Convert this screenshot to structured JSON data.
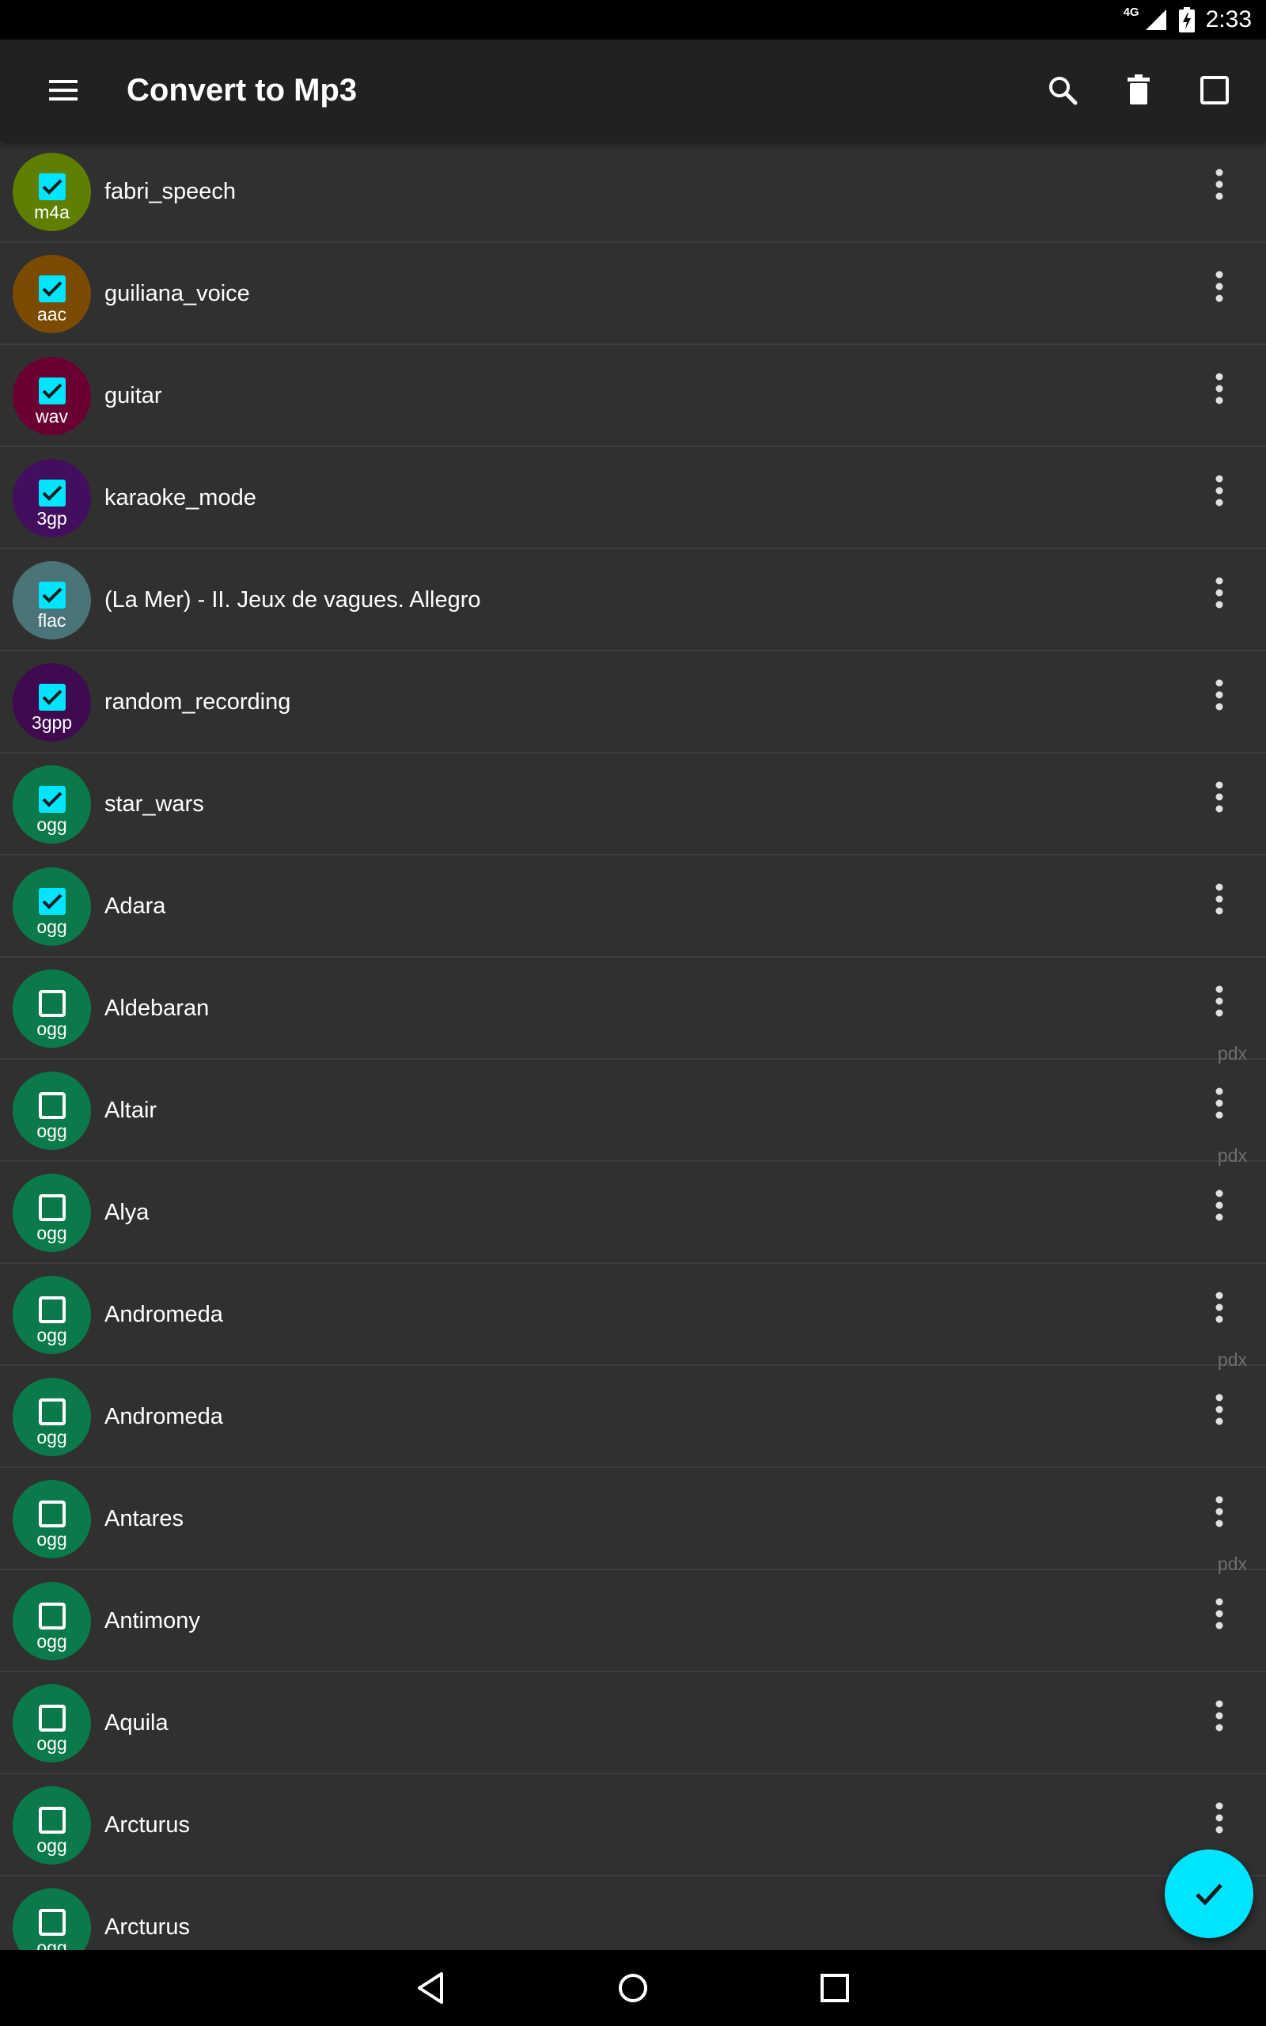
{
  "status_bar": {
    "network": "4G",
    "time": "2:33"
  },
  "app_bar": {
    "title": "Convert to Mp3",
    "icons": [
      "menu-icon",
      "search-icon",
      "delete-icon",
      "select-all-icon"
    ]
  },
  "items": [
    {
      "name": "fabri_speech",
      "ext": "m4a",
      "color": "#5f7f00",
      "checked": true,
      "badge": ""
    },
    {
      "name": "guiliana_voice",
      "ext": "aac",
      "color": "#7a4b00",
      "checked": true,
      "badge": ""
    },
    {
      "name": "guitar",
      "ext": "wav",
      "color": "#6a0032",
      "checked": true,
      "badge": ""
    },
    {
      "name": "karaoke_mode",
      "ext": "3gp",
      "color": "#440e5e",
      "checked": true,
      "badge": ""
    },
    {
      "name": "(La Mer) - II. Jeux de vagues. Allegro",
      "ext": "flac",
      "color": "#4a7478",
      "checked": true,
      "badge": ""
    },
    {
      "name": "random_recording",
      "ext": "3gpp",
      "color": "#3f0a4f",
      "checked": true,
      "badge": ""
    },
    {
      "name": "star_wars",
      "ext": "ogg",
      "color": "#0b7a4b",
      "checked": true,
      "badge": ""
    },
    {
      "name": "Adara",
      "ext": "ogg",
      "color": "#0b7a4b",
      "checked": true,
      "badge": ""
    },
    {
      "name": "Aldebaran",
      "ext": "ogg",
      "color": "#0b7a4b",
      "checked": false,
      "badge": "pdx"
    },
    {
      "name": "Altair",
      "ext": "ogg",
      "color": "#0b7a4b",
      "checked": false,
      "badge": "pdx"
    },
    {
      "name": "Alya",
      "ext": "ogg",
      "color": "#0b7a4b",
      "checked": false,
      "badge": ""
    },
    {
      "name": "Andromeda",
      "ext": "ogg",
      "color": "#0b7a4b",
      "checked": false,
      "badge": "pdx"
    },
    {
      "name": "Andromeda",
      "ext": "ogg",
      "color": "#0b7a4b",
      "checked": false,
      "badge": ""
    },
    {
      "name": "Antares",
      "ext": "ogg",
      "color": "#0b7a4b",
      "checked": false,
      "badge": "pdx"
    },
    {
      "name": "Antimony",
      "ext": "ogg",
      "color": "#0b7a4b",
      "checked": false,
      "badge": ""
    },
    {
      "name": "Aquila",
      "ext": "ogg",
      "color": "#0b7a4b",
      "checked": false,
      "badge": ""
    },
    {
      "name": "Arcturus",
      "ext": "ogg",
      "color": "#0b7a4b",
      "checked": false,
      "badge": ""
    },
    {
      "name": "Arcturus",
      "ext": "ogg",
      "color": "#0b7a4b",
      "checked": false,
      "badge": ""
    }
  ],
  "fab": {
    "icon": "check-icon",
    "color": "#00e5ff"
  },
  "nav_bar": {
    "icons": [
      "back-icon",
      "home-icon",
      "recents-icon"
    ]
  },
  "colors": {
    "checkbox_checked": "#00e5ff",
    "background": "#303030",
    "app_bar": "#212121"
  }
}
